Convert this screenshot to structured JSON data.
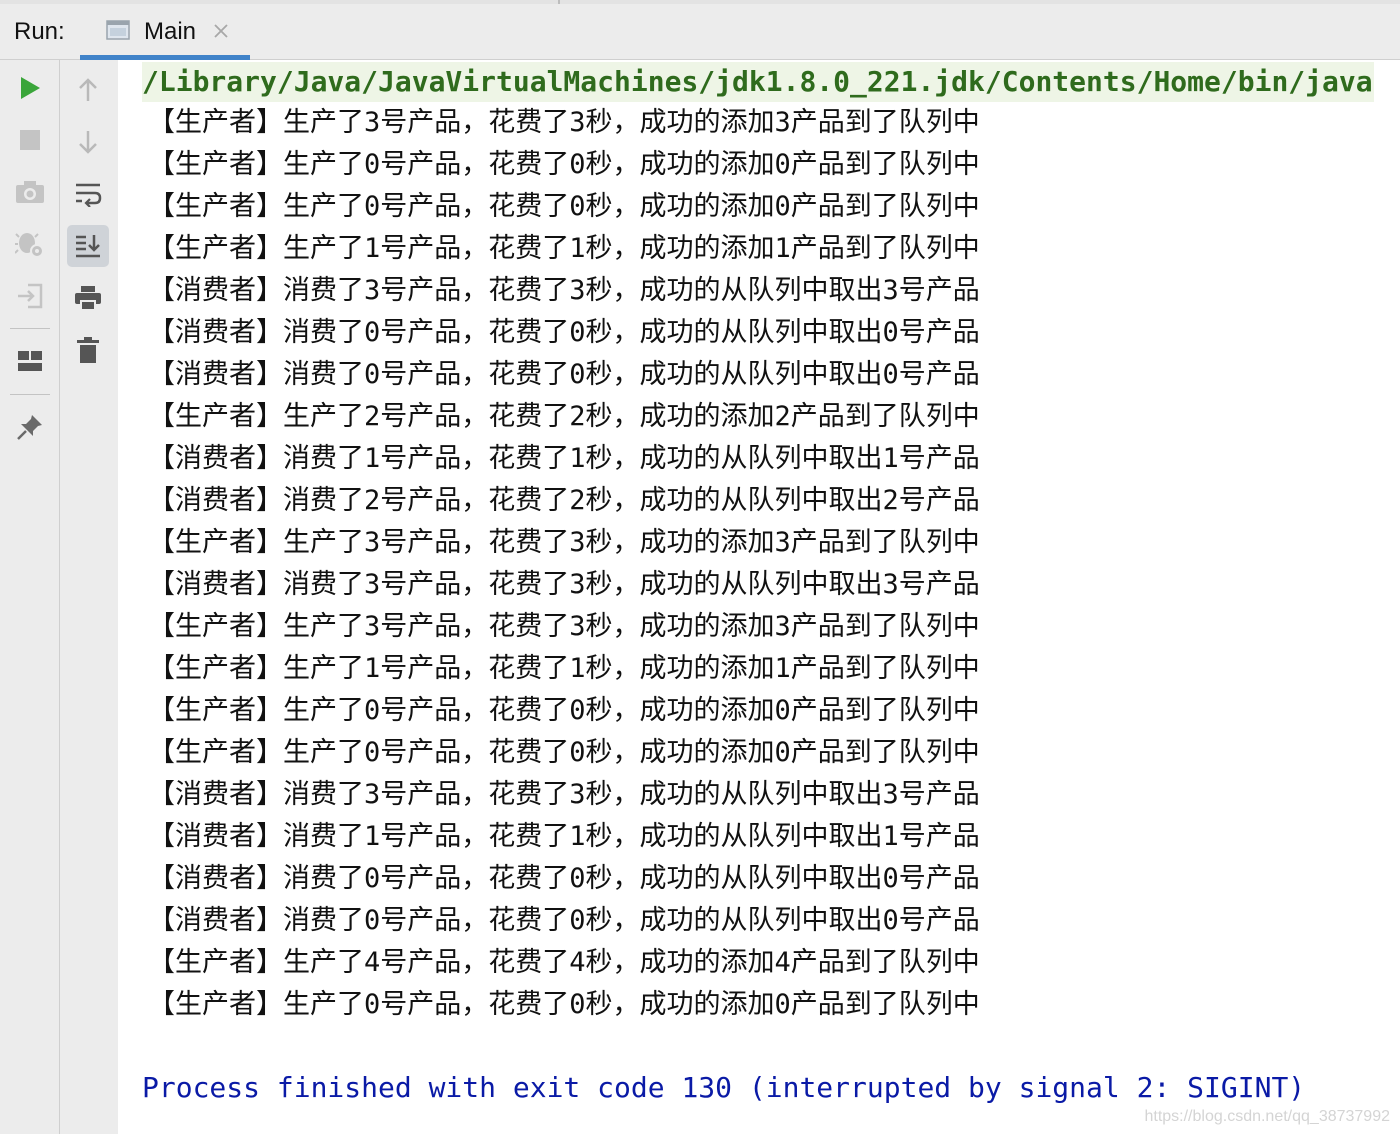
{
  "header": {
    "run_label": "Run:",
    "tab": {
      "label": "Main",
      "icon": "console-window-icon",
      "close_icon": "close-icon"
    }
  },
  "left_toolbar": [
    {
      "name": "rerun-icon",
      "color": "#3aa53a"
    },
    {
      "name": "stop-icon",
      "color": "#c4c4c4"
    },
    {
      "name": "camera-icon",
      "color": "#c4c4c4"
    },
    {
      "name": "debug-gear-icon",
      "color": "#c4c4c4"
    },
    {
      "name": "login-icon",
      "color": "#c4c4c4"
    },
    {
      "name": "layout-icon",
      "color": "#555555"
    },
    {
      "name": "pin-icon",
      "color": "#6a6a6a"
    }
  ],
  "right_toolbar": [
    {
      "name": "arrow-up-icon"
    },
    {
      "name": "arrow-down-icon"
    },
    {
      "name": "soft-wrap-icon"
    },
    {
      "name": "scroll-to-end-icon",
      "active": true
    },
    {
      "name": "print-icon"
    },
    {
      "name": "trash-icon"
    }
  ],
  "console": {
    "command": "/Library/Java/JavaVirtualMachines/jdk1.8.0_221.jdk/Contents/Home/bin/java ...",
    "lines": [
      "【生产者】生产了3号产品，花费了3秒，成功的添加3产品到了队列中",
      "【生产者】生产了0号产品，花费了0秒，成功的添加0产品到了队列中",
      "【生产者】生产了0号产品，花费了0秒，成功的添加0产品到了队列中",
      "【生产者】生产了1号产品，花费了1秒，成功的添加1产品到了队列中",
      "【消费者】消费了3号产品，花费了3秒，成功的从队列中取出3号产品",
      "【消费者】消费了0号产品，花费了0秒，成功的从队列中取出0号产品",
      "【消费者】消费了0号产品，花费了0秒，成功的从队列中取出0号产品",
      "【生产者】生产了2号产品，花费了2秒，成功的添加2产品到了队列中",
      "【消费者】消费了1号产品，花费了1秒，成功的从队列中取出1号产品",
      "【消费者】消费了2号产品，花费了2秒，成功的从队列中取出2号产品",
      "【生产者】生产了3号产品，花费了3秒，成功的添加3产品到了队列中",
      "【消费者】消费了3号产品，花费了3秒，成功的从队列中取出3号产品",
      "【生产者】生产了3号产品，花费了3秒，成功的添加3产品到了队列中",
      "【生产者】生产了1号产品，花费了1秒，成功的添加1产品到了队列中",
      "【生产者】生产了0号产品，花费了0秒，成功的添加0产品到了队列中",
      "【生产者】生产了0号产品，花费了0秒，成功的添加0产品到了队列中",
      "【消费者】消费了3号产品，花费了3秒，成功的从队列中取出3号产品",
      "【消费者】消费了1号产品，花费了1秒，成功的从队列中取出1号产品",
      "【消费者】消费了0号产品，花费了0秒，成功的从队列中取出0号产品",
      "【消费者】消费了0号产品，花费了0秒，成功的从队列中取出0号产品",
      "【生产者】生产了4号产品，花费了4秒，成功的添加4产品到了队列中",
      "【生产者】生产了0号产品，花费了0秒，成功的添加0产品到了队列中"
    ],
    "exit_message": "Process finished with exit code 130 (interrupted by signal 2: SIGINT)",
    "watermark": "https://blog.csdn.net/qq_38737992"
  },
  "colors": {
    "command_text": "#2f6b1d",
    "command_bg": "#eef5e6",
    "exit_text": "#0a1aa6",
    "tab_accent": "#4083c9"
  }
}
